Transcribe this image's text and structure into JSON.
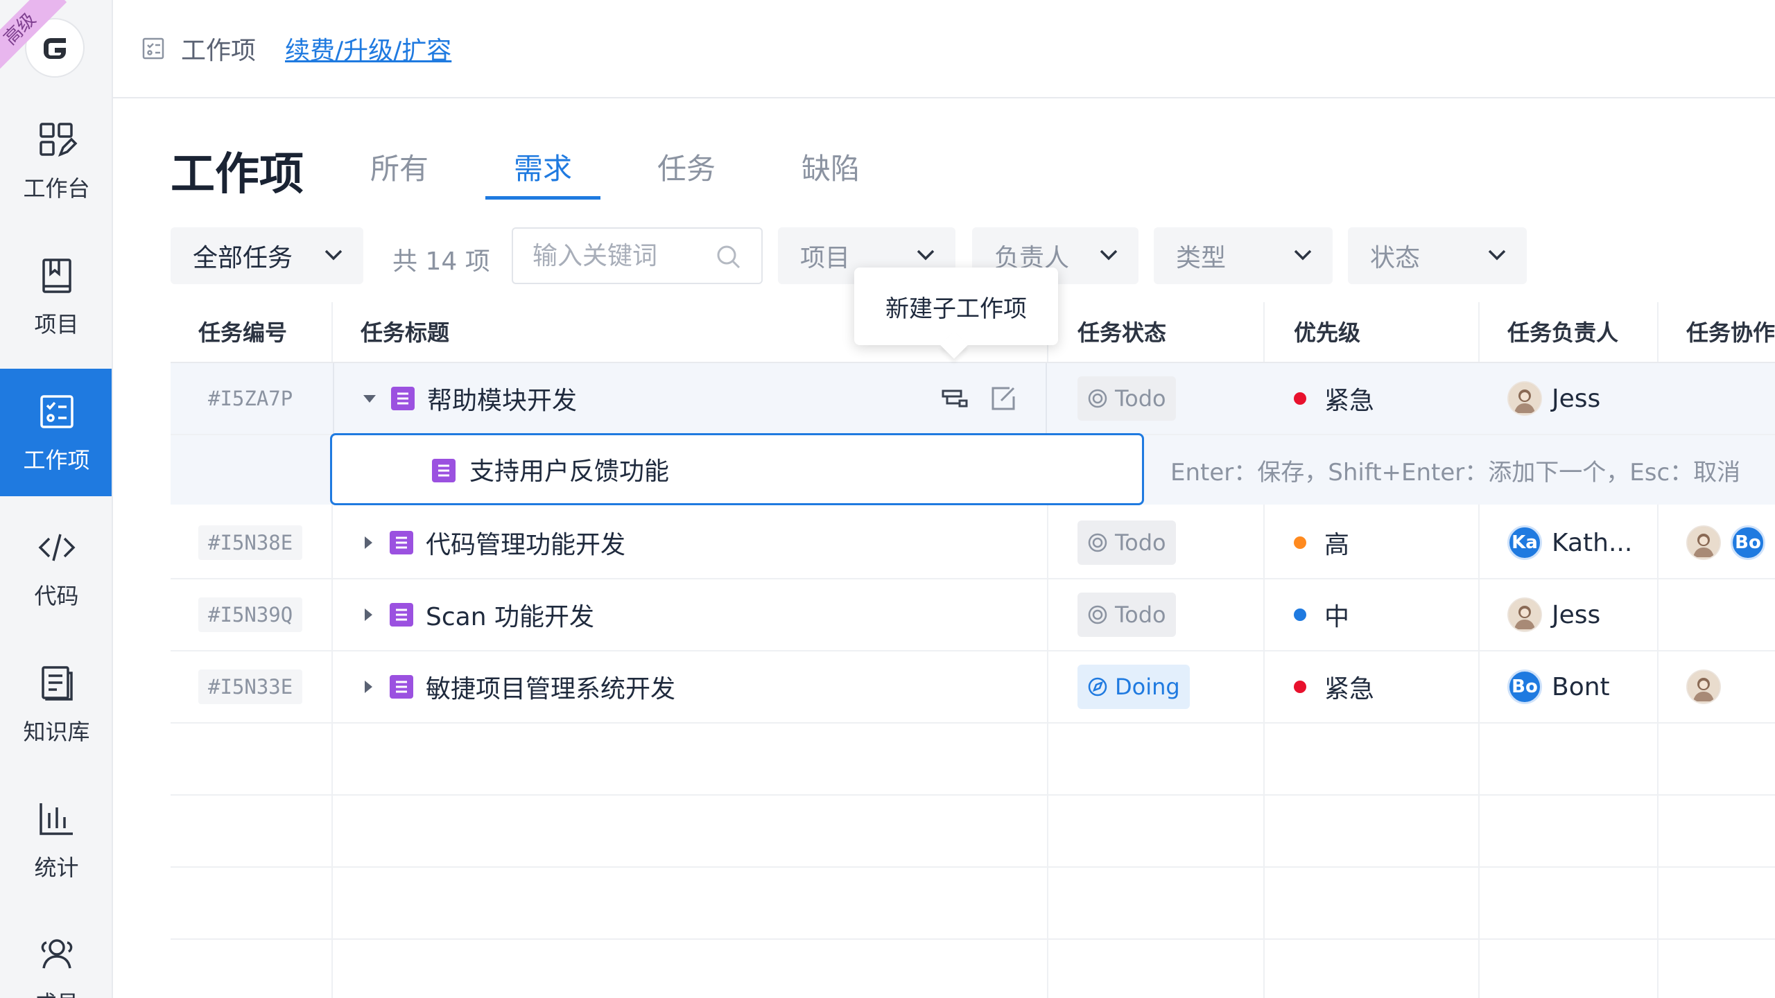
{
  "sidebar": {
    "badge": "高级",
    "logo_letter": "G",
    "items": [
      {
        "label": "工作台",
        "icon": "dashboard-icon"
      },
      {
        "label": "项目",
        "icon": "project-book-icon"
      },
      {
        "label": "工作项",
        "icon": "work-item-icon",
        "active": true
      },
      {
        "label": "代码",
        "icon": "code-icon"
      },
      {
        "label": "知识库",
        "icon": "knowledge-doc-icon"
      },
      {
        "label": "统计",
        "icon": "stats-chart-icon"
      },
      {
        "label": "成员",
        "icon": "members-icon"
      }
    ]
  },
  "topbar": {
    "crumb": "工作项",
    "renew_link": "续费/升级/扩容"
  },
  "page": {
    "title": "工作项",
    "tabs": [
      "所有",
      "需求",
      "任务",
      "缺陷"
    ],
    "active_tab": "需求"
  },
  "filters": {
    "scope": "全部任务",
    "count": "共 14 项",
    "search_placeholder": "输入关键词",
    "project": "项目",
    "assignee": "负责人",
    "type": "类型",
    "status": "状态"
  },
  "tooltip": "新建子工作项",
  "table": {
    "headers": [
      "任务编号",
      "任务标题",
      "任务状态",
      "优先级",
      "任务负责人",
      "任务协作"
    ],
    "rows": [
      {
        "id": "#I5ZA7P",
        "title": "帮助模块开发",
        "status": "Todo",
        "priority": "紧急",
        "priority_color": "#e8112d",
        "assignee": "Jess",
        "expanded": true
      },
      {
        "id": "#I5N38E",
        "title": "代码管理功能开发",
        "status": "Todo",
        "priority": "高",
        "priority_color": "#ff8a1f",
        "assignee": "Kath...",
        "assignee_initials": "Ka",
        "collaborators": [
          "avatar",
          "Bo"
        ]
      },
      {
        "id": "#I5N39Q",
        "title": "Scan 功能开发",
        "status": "Todo",
        "priority": "中",
        "priority_color": "#1f7ae0",
        "assignee": "Jess"
      },
      {
        "id": "#I5N33E",
        "title": "敏捷项目管理系统开发",
        "status": "Doing",
        "priority": "紧急",
        "priority_color": "#e8112d",
        "assignee": "Bont",
        "assignee_initials": "Bo",
        "collaborators": [
          "avatar"
        ]
      }
    ],
    "editing": {
      "value": "支持用户反馈功能",
      "hint": "Enter：保存，Shift+Enter：添加下一个，Esc：取消"
    }
  }
}
